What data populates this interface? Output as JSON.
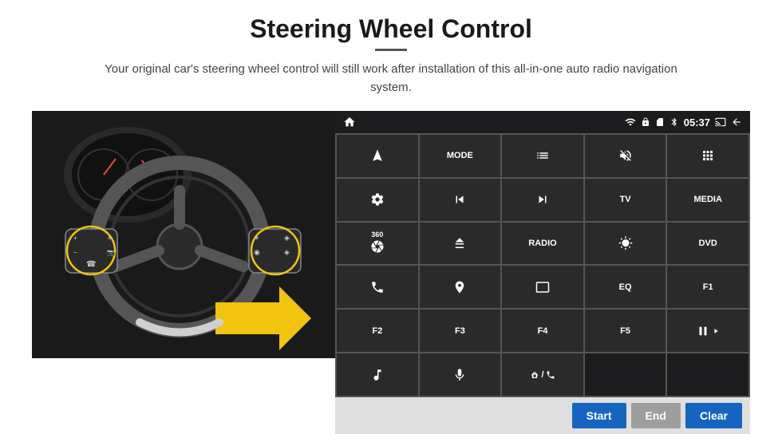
{
  "page": {
    "title": "Steering Wheel Control",
    "subtitle": "Your original car's steering wheel control will still work after installation of this all-in-one auto radio navigation system.",
    "divider_color": "#555555"
  },
  "status_bar": {
    "time": "05:37",
    "icons": [
      "wifi",
      "lock",
      "sim",
      "bluetooth",
      "cast",
      "back"
    ]
  },
  "button_grid": [
    {
      "label": "nav",
      "type": "icon",
      "row": 1,
      "col": 1
    },
    {
      "label": "MODE",
      "type": "text",
      "row": 1,
      "col": 2
    },
    {
      "label": "list",
      "type": "icon",
      "row": 1,
      "col": 3
    },
    {
      "label": "mute",
      "type": "icon",
      "row": 1,
      "col": 4
    },
    {
      "label": "apps",
      "type": "icon",
      "row": 1,
      "col": 5
    },
    {
      "label": "settings",
      "type": "icon",
      "row": 2,
      "col": 1
    },
    {
      "label": "prev",
      "type": "icon",
      "row": 2,
      "col": 2
    },
    {
      "label": "next",
      "type": "icon",
      "row": 2,
      "col": 3
    },
    {
      "label": "TV",
      "type": "text",
      "row": 2,
      "col": 4
    },
    {
      "label": "MEDIA",
      "type": "text",
      "row": 2,
      "col": 5
    },
    {
      "label": "360cam",
      "type": "icon",
      "row": 3,
      "col": 1
    },
    {
      "label": "eject",
      "type": "icon",
      "row": 3,
      "col": 2
    },
    {
      "label": "RADIO",
      "type": "text",
      "row": 3,
      "col": 3
    },
    {
      "label": "brightness",
      "type": "icon",
      "row": 3,
      "col": 4
    },
    {
      "label": "DVD",
      "type": "text",
      "row": 3,
      "col": 5
    },
    {
      "label": "phone",
      "type": "icon",
      "row": 4,
      "col": 1
    },
    {
      "label": "maps",
      "type": "icon",
      "row": 4,
      "col": 2
    },
    {
      "label": "screen",
      "type": "icon",
      "row": 4,
      "col": 3
    },
    {
      "label": "EQ",
      "type": "text",
      "row": 4,
      "col": 4
    },
    {
      "label": "F1",
      "type": "text",
      "row": 4,
      "col": 5
    },
    {
      "label": "F2",
      "type": "text",
      "row": 5,
      "col": 1
    },
    {
      "label": "F3",
      "type": "text",
      "row": 5,
      "col": 2
    },
    {
      "label": "F4",
      "type": "text",
      "row": 5,
      "col": 3
    },
    {
      "label": "F5",
      "type": "text",
      "row": 5,
      "col": 4
    },
    {
      "label": "playpause",
      "type": "icon",
      "row": 5,
      "col": 5
    },
    {
      "label": "music",
      "type": "icon",
      "row": 6,
      "col": 1
    },
    {
      "label": "mic",
      "type": "icon",
      "row": 6,
      "col": 2
    },
    {
      "label": "volphone",
      "type": "icon",
      "row": 6,
      "col": 3
    },
    {
      "label": "",
      "type": "empty",
      "row": 6,
      "col": 4
    },
    {
      "label": "",
      "type": "empty",
      "row": 6,
      "col": 5
    }
  ],
  "bottom_buttons": {
    "start_label": "Start",
    "end_label": "End",
    "clear_label": "Clear"
  }
}
